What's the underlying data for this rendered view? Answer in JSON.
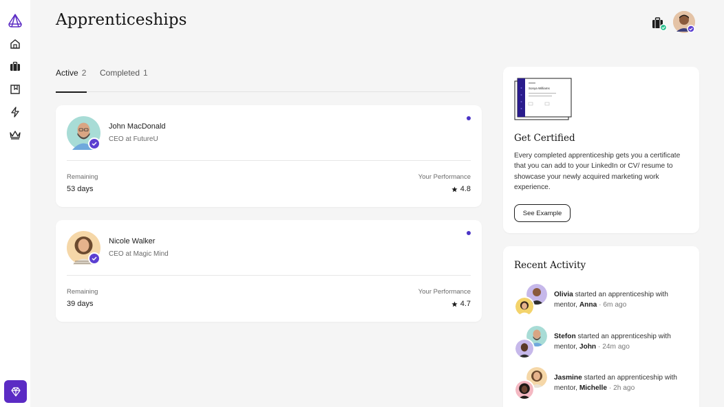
{
  "app": {
    "title": "Apprenticeships",
    "accent_color": "#5b2bc4",
    "sidebar_icons": [
      "logo-icon",
      "home-icon",
      "briefcase-icon",
      "bookmark-icon",
      "lightning-icon",
      "crown-icon",
      "diamond-icon"
    ]
  },
  "tabs": [
    {
      "label": "Active",
      "count": "2"
    },
    {
      "label": "Completed",
      "count": "1"
    }
  ],
  "apprenticeships": [
    {
      "name": "John MacDonald",
      "role": "CEO at FutureU",
      "remaining_label": "Remaining",
      "remaining_value": "53 days",
      "performance_label": "Your Performance",
      "performance_value": "4.8",
      "avatar_bg": "#a8dcd6"
    },
    {
      "name": "Nicole Walker",
      "role": "CEO at Magic Mind",
      "remaining_label": "Remaining",
      "remaining_value": "39 days",
      "performance_label": "Your Performance",
      "performance_value": "4.7",
      "avatar_bg": "#f5d7a8"
    }
  ],
  "certificate": {
    "preview_name": "Sonya Williams",
    "title": "Get Certified",
    "text": "Every completed apprenticeship gets you a certificate that you can add to your LinkedIn or CV/ resume to showcase your newly acquired marketing work experience.",
    "button": "See Example"
  },
  "activity": {
    "title": "Recent Activity",
    "items": [
      {
        "user": "Olivia",
        "text": " started an apprenticeship with mentor, ",
        "mentor": "Anna",
        "ago": " · 6m ago",
        "bg1": "#c6b8ea",
        "bg2": "#f3d36b"
      },
      {
        "user": "Stefon",
        "text": " started an apprenticeship with mentor, ",
        "mentor": "John",
        "ago": " · 24m ago",
        "bg1": "#a8dcd6",
        "bg2": "#c6b8ea"
      },
      {
        "user": "Jasmine",
        "text": " started an apprenticeship with mentor, ",
        "mentor": "Michelle",
        "ago": " · 2h ago",
        "bg1": "#f5d7a8",
        "bg2": "#f4b8c2"
      }
    ]
  }
}
